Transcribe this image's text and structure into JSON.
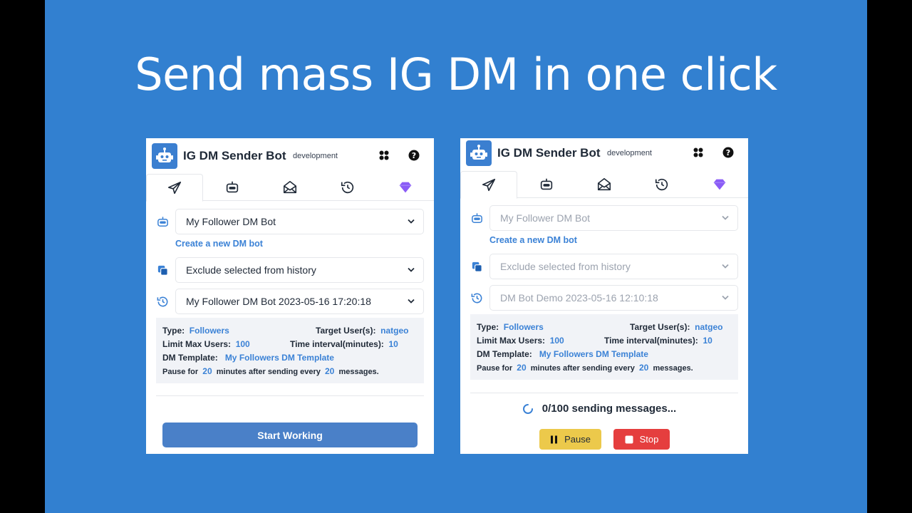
{
  "slide": {
    "title": "Send mass IG DM in one click",
    "bg": "#3280d0"
  },
  "app": {
    "title": "IG DM Sender Bot",
    "env": "development",
    "accent": "#3b82d6",
    "premium": "#8b5cf6"
  },
  "tabs": [
    {
      "icon": "send-icon"
    },
    {
      "icon": "robot-icon"
    },
    {
      "icon": "mail-open-icon"
    },
    {
      "icon": "history-icon"
    },
    {
      "icon": "diamond-icon"
    }
  ],
  "left": {
    "bot_select": "My Follower DM Bot",
    "create_link": "Create a new DM bot",
    "exclude_select": "Exclude selected from history",
    "history_select": "My Follower DM Bot 2023-05-16 17:20:18",
    "info": {
      "type_label": "Type:",
      "type_value": "Followers",
      "target_label": "Target User(s):",
      "target_value": "natgeo",
      "limit_label": "Limit Max Users:",
      "limit_value": "100",
      "interval_label": "Time interval(minutes):",
      "interval_value": "10",
      "template_label": "DM Template:",
      "template_value": "My Followers DM Template",
      "pause_prefix": "Pause for",
      "pause_minutes": "20",
      "pause_mid": "minutes after sending every",
      "pause_count": "20",
      "pause_suffix": "messages."
    },
    "start_button": "Start Working"
  },
  "right": {
    "bot_select": "My Follower DM Bot",
    "create_link": "Create a new DM bot",
    "exclude_select": "Exclude selected from history",
    "history_select": "DM Bot Demo 2023-05-16 12:10:18",
    "info": {
      "type_label": "Type:",
      "type_value": "Followers",
      "target_label": "Target User(s):",
      "target_value": "natgeo",
      "limit_label": "Limit Max Users:",
      "limit_value": "100",
      "interval_label": "Time interval(minutes):",
      "interval_value": "10",
      "template_label": "DM Template:",
      "template_value": "My Followers DM Template",
      "pause_prefix": "Pause for",
      "pause_minutes": "20",
      "pause_mid": "minutes after sending every",
      "pause_count": "20",
      "pause_suffix": "messages."
    },
    "status_text": "0/100 sending messages...",
    "pause_button": "Pause",
    "stop_button": "Stop"
  }
}
